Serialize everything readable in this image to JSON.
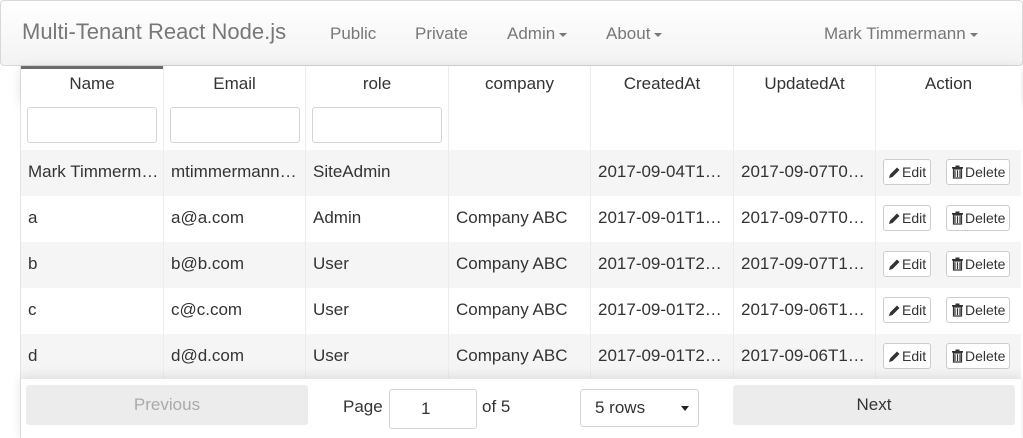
{
  "navbar": {
    "brand": "Multi-Tenant React Node.js",
    "items": [
      "Public",
      "Private",
      "Admin",
      "About"
    ],
    "user": "Mark Timmermann"
  },
  "table": {
    "headers": [
      "Name",
      "Email",
      "role",
      "company",
      "CreatedAt",
      "UpdatedAt",
      "Action"
    ],
    "rows": [
      [
        "Mark Timmermann",
        "mtimmermann@live.com",
        "SiteAdmin",
        "",
        "2017-09-04T1…",
        "2017-09-07T0…"
      ],
      [
        "a",
        "a@a.com",
        "Admin",
        "Company ABC",
        "2017-09-01T1…",
        "2017-09-07T0…"
      ],
      [
        "b",
        "b@b.com",
        "User",
        "Company ABC",
        "2017-09-01T2…",
        "2017-09-07T1…"
      ],
      [
        "c",
        "c@c.com",
        "User",
        "Company ABC",
        "2017-09-01T2…",
        "2017-09-06T1…"
      ],
      [
        "d",
        "d@d.com",
        "User",
        "Company ABC",
        "2017-09-01T2…",
        "2017-09-06T1…"
      ]
    ],
    "edit_label": "Edit",
    "delete_label": "Delete"
  },
  "pagination": {
    "previous": "Previous",
    "next": "Next",
    "page_label": "Page",
    "page_value": "1",
    "of_label": "of 5",
    "rows_option": "5 rows"
  },
  "colors": {
    "navbar_bg": "#f5f5f5",
    "row_alt": "#f5f5f5",
    "button_disabled": "#ececec"
  }
}
